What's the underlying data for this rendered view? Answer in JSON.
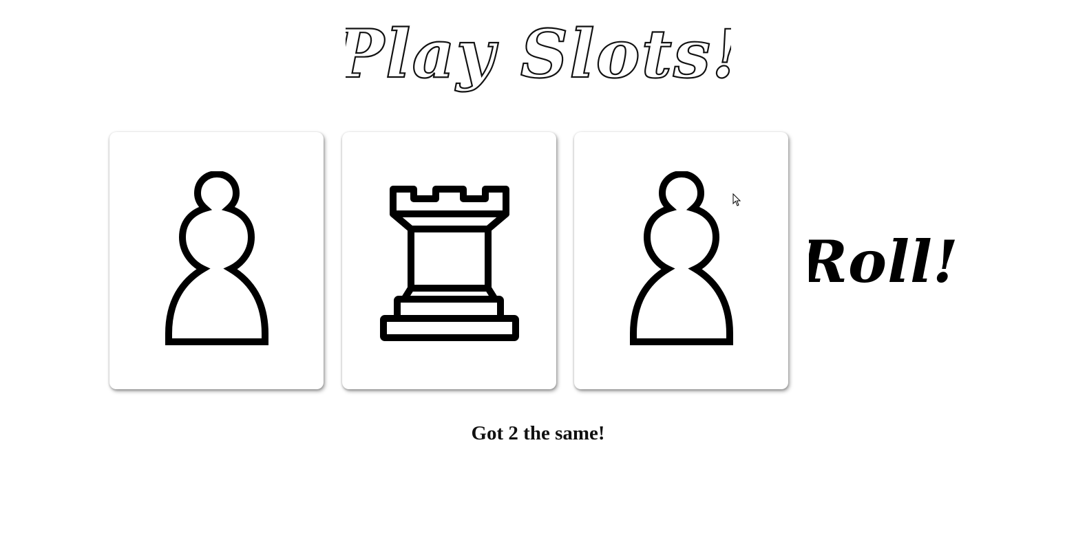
{
  "title": "Play Slots!",
  "slots": [
    {
      "piece": "pawn",
      "icon": "pawn-icon"
    },
    {
      "piece": "rook",
      "icon": "rook-icon"
    },
    {
      "piece": "pawn",
      "icon": "pawn-icon"
    }
  ],
  "roll_button": {
    "label": "Roll!"
  },
  "result_message": "Got 2 the same!"
}
